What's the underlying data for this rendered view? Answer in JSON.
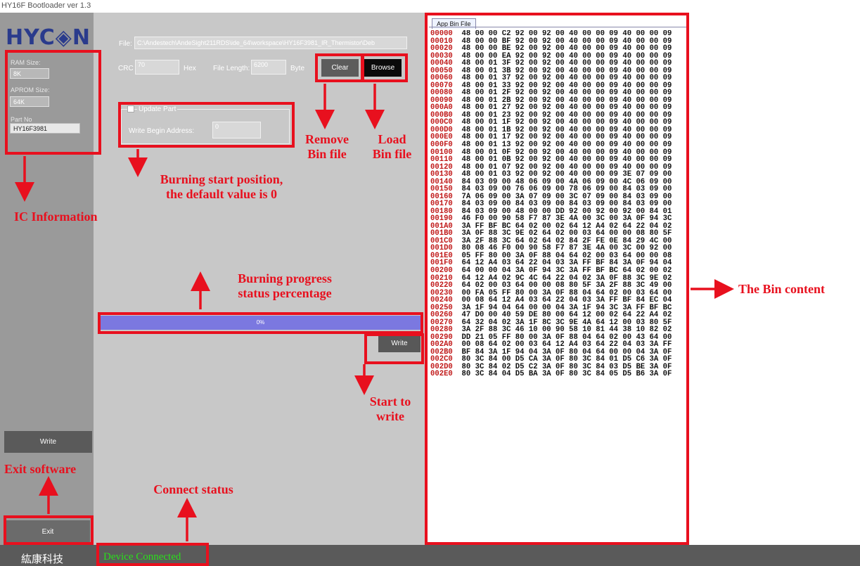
{
  "window_title": "HY16F Bootloader ver 1.3",
  "logo_text": "HYC◈N",
  "sidebar": {
    "ram_label": "RAM Size:",
    "ram_value": "8K",
    "aprom_label": "APROM Size:",
    "aprom_value": "64K",
    "part_label": "Part No",
    "part_value": "HY16F3981",
    "write_button": "Write",
    "exit_button": "Exit",
    "company": "紘康科技"
  },
  "main": {
    "file_label": "File:",
    "file_path": "C:\\Andestech\\AndeSight211RDS\\ide_64\\workspace\\HY16F3981_IR_Thermistor\\Deb",
    "crc_label": "CRC",
    "crc_value": "70",
    "crc_unit": "Hex",
    "length_label": "File Length:",
    "length_value": "6200",
    "length_unit": "Byte",
    "clear_button": "Clear",
    "browse_button": "Browse",
    "update_part_label": "Update Part",
    "write_begin_label": "Write Begin Address:",
    "write_begin_value": "0",
    "progress_text": "0%",
    "progress_value": 0,
    "write_button": "Write"
  },
  "status": {
    "connection_text": "Device Connected"
  },
  "right": {
    "tab_label": "App Bin File"
  },
  "annotations": {
    "remove": "Remove\nBin file",
    "load": "Load\nBin file",
    "burn_start": "Burning start position,\nthe default value is 0",
    "ic_info": "IC Information",
    "progress": "Burning progress\nstatus percentage",
    "start_write": "Start to\nwrite",
    "exit": "Exit software",
    "connect": "Connect status",
    "bin_content": "The Bin content"
  },
  "colors": {
    "annotation_red": "#e8101e",
    "progress_fill": "#7b78e0",
    "connected_green": "#29e01a",
    "logo_blue": "#2a3b8c"
  },
  "hex_rows": [
    [
      "00000",
      "48 00 00 C2 92 00 92 00 40 00 00 09 40 00 00 09"
    ],
    [
      "00010",
      "48 00 00 BF 92 00 92 00 40 00 00 09 40 00 00 09"
    ],
    [
      "00020",
      "48 00 00 BE 92 00 92 00 40 00 00 09 40 00 00 09"
    ],
    [
      "00030",
      "48 00 00 EA 92 00 92 00 40 00 00 09 40 00 00 09"
    ],
    [
      "00040",
      "48 00 01 3F 92 00 92 00 40 00 00 09 40 00 00 09"
    ],
    [
      "00050",
      "48 00 01 3B 92 00 92 00 40 00 00 09 40 00 00 09"
    ],
    [
      "00060",
      "48 00 01 37 92 00 92 00 40 00 00 09 40 00 00 09"
    ],
    [
      "00070",
      "48 00 01 33 92 00 92 00 40 00 00 09 40 00 00 09"
    ],
    [
      "00080",
      "48 00 01 2F 92 00 92 00 40 00 00 09 40 00 00 09"
    ],
    [
      "00090",
      "48 00 01 2B 92 00 92 00 40 00 00 09 40 00 00 09"
    ],
    [
      "000A0",
      "48 00 01 27 92 00 92 00 40 00 00 09 40 00 00 09"
    ],
    [
      "000B0",
      "48 00 01 23 92 00 92 00 40 00 00 09 40 00 00 09"
    ],
    [
      "000C0",
      "48 00 01 1F 92 00 92 00 40 00 00 09 40 00 00 09"
    ],
    [
      "000D0",
      "48 00 01 1B 92 00 92 00 40 00 00 09 40 00 00 09"
    ],
    [
      "000E0",
      "48 00 01 17 92 00 92 00 40 00 00 09 40 00 00 09"
    ],
    [
      "000F0",
      "48 00 01 13 92 00 92 00 40 00 00 09 40 00 00 09"
    ],
    [
      "00100",
      "48 00 01 0F 92 00 92 00 40 00 00 09 40 00 00 09"
    ],
    [
      "00110",
      "48 00 01 0B 92 00 92 00 40 00 00 09 40 00 00 09"
    ],
    [
      "00120",
      "48 00 01 07 92 00 92 00 40 00 00 09 40 00 00 09"
    ],
    [
      "00130",
      "48 00 01 03 92 00 92 00 40 00 00 09 3E 07 09 00"
    ],
    [
      "00140",
      "84 03 09 00 48 06 09 00 4A 06 09 00 4C 06 09 00"
    ],
    [
      "00150",
      "84 03 09 00 76 06 09 00 78 06 09 00 84 03 09 00"
    ],
    [
      "00160",
      "7A 06 09 00 3A 07 09 00 3C 07 09 00 84 03 09 00"
    ],
    [
      "00170",
      "84 03 09 00 84 03 09 00 84 03 09 00 84 03 09 00"
    ],
    [
      "00180",
      "84 03 09 00 48 00 00 DD 92 00 92 00 92 00 84 01"
    ],
    [
      "00190",
      "46 F0 00 90 58 F7 87 3E 4A 00 3C 00 3A 0F 94 3C"
    ],
    [
      "001A0",
      "3A FF BF BC 64 02 00 02 64 12 A4 02 64 22 04 02"
    ],
    [
      "001B0",
      "3A 0F 88 3C 9E 02 64 02 00 03 64 00 00 08 80 5F"
    ],
    [
      "001C0",
      "3A 2F 88 3C 64 02 64 02 84 2F FE 0E 84 29 4C 00"
    ],
    [
      "001D0",
      "80 08 46 F0 00 90 58 F7 87 3E 4A 00 3C 00 92 00"
    ],
    [
      "001E0",
      "05 FF 80 00 3A 0F 88 04 64 02 00 03 64 00 00 08"
    ],
    [
      "001F0",
      "64 12 A4 03 64 22 04 03 3A FF BF 84 3A 0F 94 04"
    ],
    [
      "00200",
      "64 00 00 04 3A 0F 94 3C 3A FF BF BC 64 02 00 02"
    ],
    [
      "00210",
      "64 12 A4 02 9C 4C 64 22 04 02 3A 0F 88 3C 9E 02"
    ],
    [
      "00220",
      "64 02 00 03 64 00 00 08 80 5F 3A 2F 88 3C 49 00"
    ],
    [
      "00230",
      "00 FA 05 FF 80 00 3A 0F 88 04 64 02 00 03 64 00"
    ],
    [
      "00240",
      "00 08 64 12 A4 03 64 22 04 03 3A FF BF 84 EC 04"
    ],
    [
      "00250",
      "3A 1F 94 04 64 00 00 04 3A 1F 94 3C 3A FF BF BC"
    ],
    [
      "00260",
      "47 D0 00 40 59 DE 80 00 64 12 00 02 64 22 A4 02"
    ],
    [
      "00270",
      "64 32 04 02 3A 1F 8C 3C 9E 4A 64 12 00 03 80 5F"
    ],
    [
      "00280",
      "3A 2F 88 3C 46 10 00 90 58 10 81 44 38 10 82 02"
    ],
    [
      "00290",
      "DD 21 05 FF 80 00 3A 0F 88 04 64 02 00 43 64 00"
    ],
    [
      "002A0",
      "00 08 64 02 00 03 64 12 A4 03 64 22 04 03 3A FF"
    ],
    [
      "002B0",
      "BF 84 3A 1F 94 04 3A 0F 80 04 64 00 00 04 3A 0F"
    ],
    [
      "002C0",
      "80 3C 84 00 D5 CA 3A 0F 80 3C 84 01 D5 C6 3A 0F"
    ],
    [
      "002D0",
      "80 3C 84 02 D5 C2 3A 0F 80 3C 84 03 D5 BE 3A 0F"
    ],
    [
      "002E0",
      "80 3C 84 04 D5 BA 3A 0F 80 3C 84 05 D5 B6 3A 0F"
    ]
  ]
}
